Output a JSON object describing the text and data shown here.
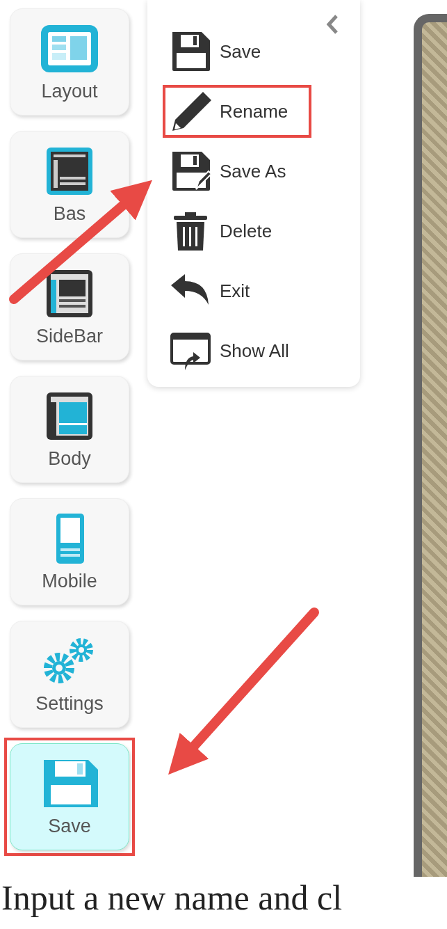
{
  "tool_tiles": [
    {
      "label": "Layout",
      "selected": false,
      "annotated": false
    },
    {
      "label": "Bas",
      "selected": false,
      "annotated": false
    },
    {
      "label": "SideBar",
      "selected": false,
      "annotated": false
    },
    {
      "label": "Body",
      "selected": false,
      "annotated": false
    },
    {
      "label": "Mobile",
      "selected": false,
      "annotated": false
    },
    {
      "label": "Settings",
      "selected": false,
      "annotated": false
    },
    {
      "label": "Save",
      "selected": true,
      "annotated": true
    }
  ],
  "file_menu": {
    "items": [
      {
        "label": "Save",
        "annotated": false
      },
      {
        "label": "Rename",
        "annotated": true
      },
      {
        "label": "Save As",
        "annotated": false
      },
      {
        "label": "Delete",
        "annotated": false
      },
      {
        "label": "Exit",
        "annotated": false
      },
      {
        "label": "Show All",
        "annotated": false
      }
    ]
  },
  "caption": "Input a new name and cl"
}
